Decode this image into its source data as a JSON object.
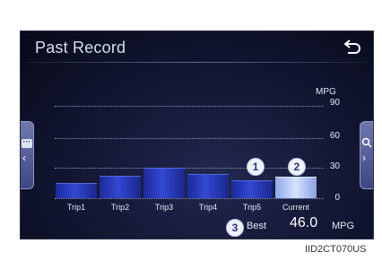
{
  "screen": {
    "title": "Past Record",
    "unit": "MPG",
    "axis_ticks": [
      "90",
      "60",
      "30",
      "0"
    ],
    "best": {
      "label": "Best",
      "value": "46.0",
      "unit": "MPG"
    }
  },
  "callouts": [
    "1",
    "2",
    "3"
  ],
  "image_id": "IID2CT070US",
  "chart_data": {
    "type": "bar",
    "categories": [
      "Trip1",
      "Trip2",
      "Trip3",
      "Trip4",
      "Trip5",
      "Current"
    ],
    "values": [
      14,
      21,
      29,
      23,
      17,
      20
    ],
    "ylabel": "MPG",
    "ylim": [
      0,
      90
    ],
    "highlight": "Current",
    "colors": {
      "bar": "#2b3dc5",
      "current": "#c9d6ff"
    }
  },
  "icons": {
    "back": "back-icon",
    "menu": "menu-icon",
    "zoom": "zoom-icon",
    "left": "chevron-left-icon",
    "right": "chevron-right-icon"
  }
}
